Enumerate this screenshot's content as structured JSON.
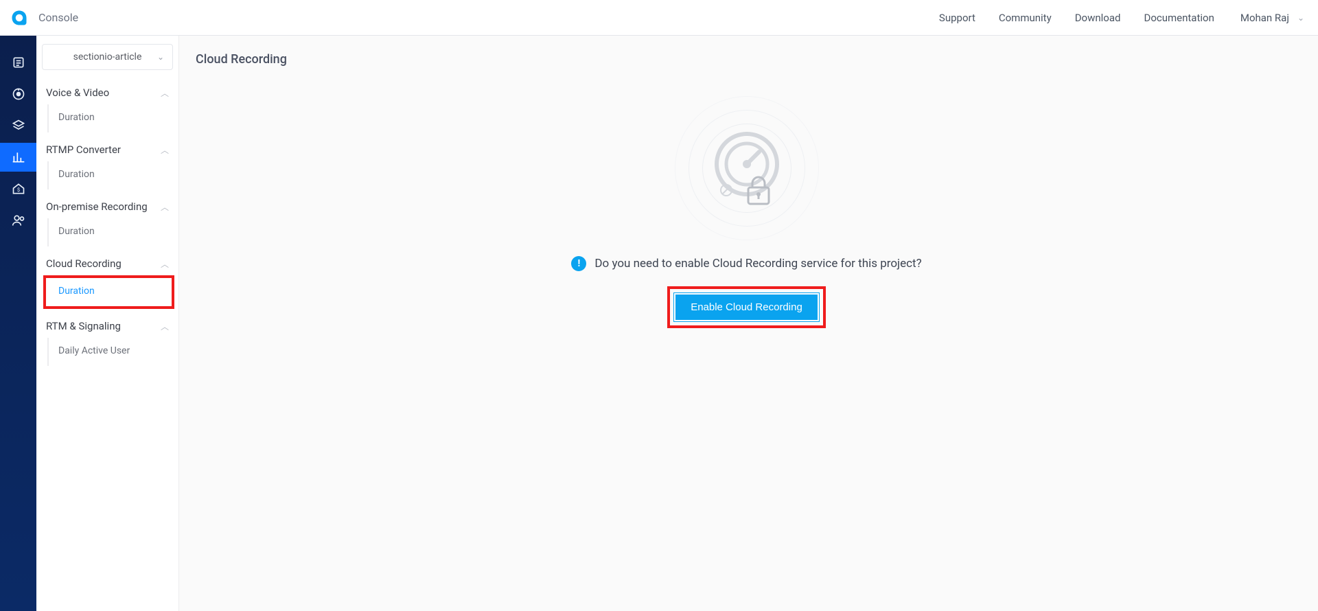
{
  "header": {
    "console_label": "Console",
    "links": {
      "support": "Support",
      "community": "Community",
      "download": "Download",
      "documentation": "Documentation"
    },
    "user_name": "Mohan Raj"
  },
  "left_nav": {
    "project_selected": "sectionio-article",
    "groups": [
      {
        "label": "Voice & Video",
        "items": [
          "Duration"
        ]
      },
      {
        "label": "RTMP Converter",
        "items": [
          "Duration"
        ]
      },
      {
        "label": "On-premise Recording",
        "items": [
          "Duration"
        ]
      },
      {
        "label": "Cloud Recording",
        "items": [
          "Duration"
        ]
      },
      {
        "label": "RTM & Signaling",
        "items": [
          "Daily Active User"
        ]
      }
    ]
  },
  "main": {
    "page_title": "Cloud Recording",
    "prompt": "Do you need to enable Cloud Recording service for this project?",
    "enable_button": "Enable Cloud Recording"
  }
}
